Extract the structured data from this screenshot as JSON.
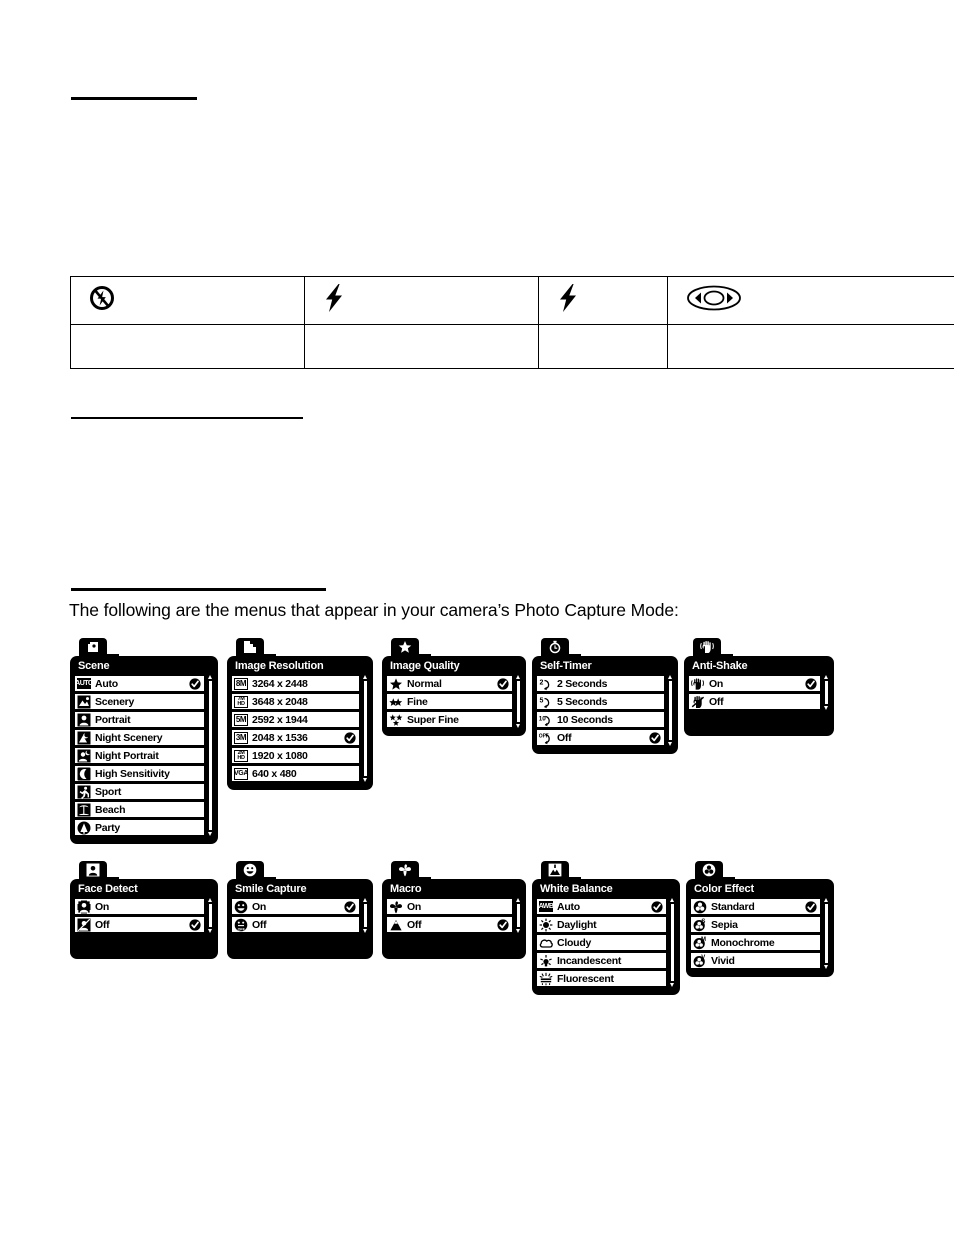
{
  "document": {
    "intro_text": "The following are the menus that appear in your camera’s Photo Capture Mode:"
  },
  "flash_table": {
    "rows": [
      {
        "cells": [
          {
            "icon": "flash-off-icon"
          },
          {
            "icon": "flash-on-icon"
          },
          {
            "icon": "flash-auto-icon"
          },
          {
            "icon": "red-eye-reduction-icon"
          }
        ]
      },
      {
        "cells": [
          {
            "text": ""
          },
          {
            "text": ""
          },
          {
            "text": ""
          },
          {
            "text": ""
          }
        ]
      }
    ]
  },
  "menus": [
    {
      "id": "scene",
      "title": "Scene",
      "tab_icon": "scene-icon",
      "black_pad": false,
      "items": [
        {
          "label": "Auto",
          "icon": "auto-badge",
          "selected": true
        },
        {
          "label": "Scenery",
          "icon": "scenery-icon",
          "selected": false
        },
        {
          "label": "Portrait",
          "icon": "portrait-icon",
          "selected": false
        },
        {
          "label": "Night Scenery",
          "icon": "night-scenery-icon",
          "selected": false
        },
        {
          "label": "Night Portrait",
          "icon": "night-portrait-icon",
          "selected": false
        },
        {
          "label": "High Sensitivity",
          "icon": "moon-icon",
          "selected": false
        },
        {
          "label": "Sport",
          "icon": "sport-icon",
          "selected": false
        },
        {
          "label": "Beach",
          "icon": "beach-icon",
          "selected": false
        },
        {
          "label": "Party",
          "icon": "party-icon",
          "selected": false
        }
      ]
    },
    {
      "id": "image-resolution",
      "title": "Image Resolution",
      "tab_icon": "resolution-icon",
      "black_pad": false,
      "items": [
        {
          "label": "3264 x 2448",
          "icon": "8m-badge",
          "selected": false
        },
        {
          "label": "3648 x 2048",
          "icon": "7mhd-badge",
          "selected": false
        },
        {
          "label": "2592 x 1944",
          "icon": "5m-badge",
          "selected": false
        },
        {
          "label": "2048 x 1536",
          "icon": "3m-badge",
          "selected": true
        },
        {
          "label": "1920 x 1080",
          "icon": "2mhd-badge",
          "selected": false
        },
        {
          "label": "640 x 480",
          "icon": "vga-badge",
          "selected": false
        }
      ]
    },
    {
      "id": "image-quality",
      "title": "Image Quality",
      "tab_icon": "star-icon",
      "black_pad": false,
      "items": [
        {
          "label": "Normal",
          "icon": "one-star-icon",
          "selected": true
        },
        {
          "label": "Fine",
          "icon": "two-star-icon",
          "selected": false
        },
        {
          "label": "Super Fine",
          "icon": "three-star-icon",
          "selected": false
        }
      ]
    },
    {
      "id": "self-timer",
      "title": "Self-Timer",
      "tab_icon": "timer-icon",
      "black_pad": false,
      "items": [
        {
          "label": "2 Seconds",
          "icon": "timer-2-icon",
          "selected": false
        },
        {
          "label": "5 Seconds",
          "icon": "timer-5-icon",
          "selected": false
        },
        {
          "label": "10 Seconds",
          "icon": "timer-10-icon",
          "selected": false
        },
        {
          "label": "Off",
          "icon": "timer-off-icon",
          "selected": true
        }
      ]
    },
    {
      "id": "anti-shake",
      "title": "Anti-Shake",
      "tab_icon": "hand-shake-icon",
      "black_pad": true,
      "items": [
        {
          "label": "On",
          "icon": "hand-shake-icon",
          "selected": true
        },
        {
          "label": "Off",
          "icon": "hand-still-icon",
          "selected": false
        }
      ]
    },
    {
      "id": "face-detect",
      "title": "Face Detect",
      "tab_icon": "face-icon",
      "black_pad": true,
      "items": [
        {
          "label": "On",
          "icon": "face-on-icon",
          "selected": false
        },
        {
          "label": "Off",
          "icon": "face-off-icon",
          "selected": true
        }
      ]
    },
    {
      "id": "smile-capture",
      "title": "Smile Capture",
      "tab_icon": "smile-icon",
      "black_pad": true,
      "items": [
        {
          "label": "On",
          "icon": "smile-on-icon",
          "selected": true
        },
        {
          "label": "Off",
          "icon": "smile-off-icon",
          "selected": false
        }
      ]
    },
    {
      "id": "macro",
      "title": "Macro",
      "tab_icon": "flower-icon",
      "black_pad": true,
      "items": [
        {
          "label": "On",
          "icon": "flower-icon",
          "selected": false
        },
        {
          "label": "Off",
          "icon": "mountain-icon",
          "selected": true
        }
      ]
    },
    {
      "id": "white-balance",
      "title": "White Balance",
      "tab_icon": "white-balance-icon",
      "black_pad": false,
      "items": [
        {
          "label": "Auto",
          "icon": "awb-badge",
          "selected": true
        },
        {
          "label": "Daylight",
          "icon": "sun-icon",
          "selected": false
        },
        {
          "label": "Cloudy",
          "icon": "cloud-icon",
          "selected": false
        },
        {
          "label": "Incandescent",
          "icon": "incandescent-icon",
          "selected": false
        },
        {
          "label": "Fluorescent",
          "icon": "fluorescent-icon",
          "selected": false
        }
      ]
    },
    {
      "id": "color-effect",
      "title": "Color Effect",
      "tab_icon": "color-wheel-icon",
      "black_pad": false,
      "items": [
        {
          "label": "Standard",
          "icon": "color-standard-icon",
          "selected": true
        },
        {
          "label": "Sepia",
          "icon": "color-sepia-icon",
          "selected": false
        },
        {
          "label": "Monochrome",
          "icon": "color-monochrome-icon",
          "selected": false
        },
        {
          "label": "Vivid",
          "icon": "color-vivid-icon",
          "selected": false
        }
      ]
    }
  ]
}
